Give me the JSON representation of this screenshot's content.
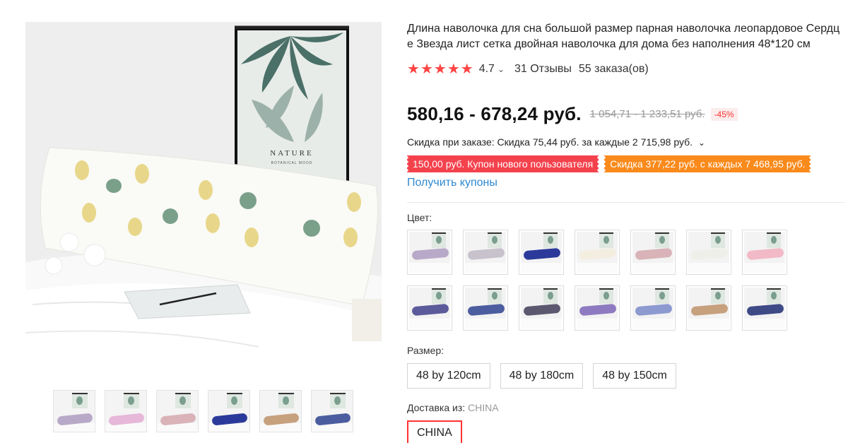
{
  "product": {
    "title": "Длина наволочка для сна большой размер парная наволочка леопардовое Сердце Звезда лист сетка двойная наволочка для дома без наполнения 48*120 см",
    "rating": {
      "stars": 5,
      "score": "4.7",
      "reviews": "31 Отзывы",
      "orders": "55 заказа(ов)"
    },
    "price": "580,16 - 678,24 руб.",
    "old_price": "1 054,71 - 1 233,51 руб.",
    "discount_badge": "-45%",
    "order_discount": "Скидка при заказе: Скидка 75,44 руб. за каждые 2 715,98 руб.",
    "coupons": [
      {
        "label": "150,00 руб. Купон нового пользователя",
        "color": "#f4424d"
      },
      {
        "label": "Скидка 377,22 руб. с каждых 7 468,95 руб.",
        "color": "#f98a1b"
      }
    ],
    "get_coupons": "Получить купоны",
    "color_label": "Цвет:",
    "color_swatches": [
      "#b9a9c8",
      "#c7c2cc",
      "#2b3a9a",
      "#f3eee0",
      "#d9b3b8",
      "#efefea",
      "#f2b9c6",
      "#5b5a9a",
      "#4c5d9f",
      "#5c5870",
      "#8d7ac0",
      "#8c9ad0",
      "#c7a07e",
      "#3e4a86"
    ],
    "size_label": "Размер:",
    "sizes": [
      "48 by 120cm",
      "48 by 180cm",
      "48 by 150cm"
    ],
    "ship_label": "Доставка из:",
    "ship_value": "CHINA",
    "ship_option": "CHINA"
  },
  "gallery": {
    "main_image_text": [
      "NATURE",
      "BOTANICAL MOOD"
    ],
    "thumbnails": [
      "#b9a9c8",
      "#e6b7d9",
      "#d9b3b8",
      "#2b3a9a",
      "#c7a07e",
      "#4c5d9f"
    ]
  }
}
